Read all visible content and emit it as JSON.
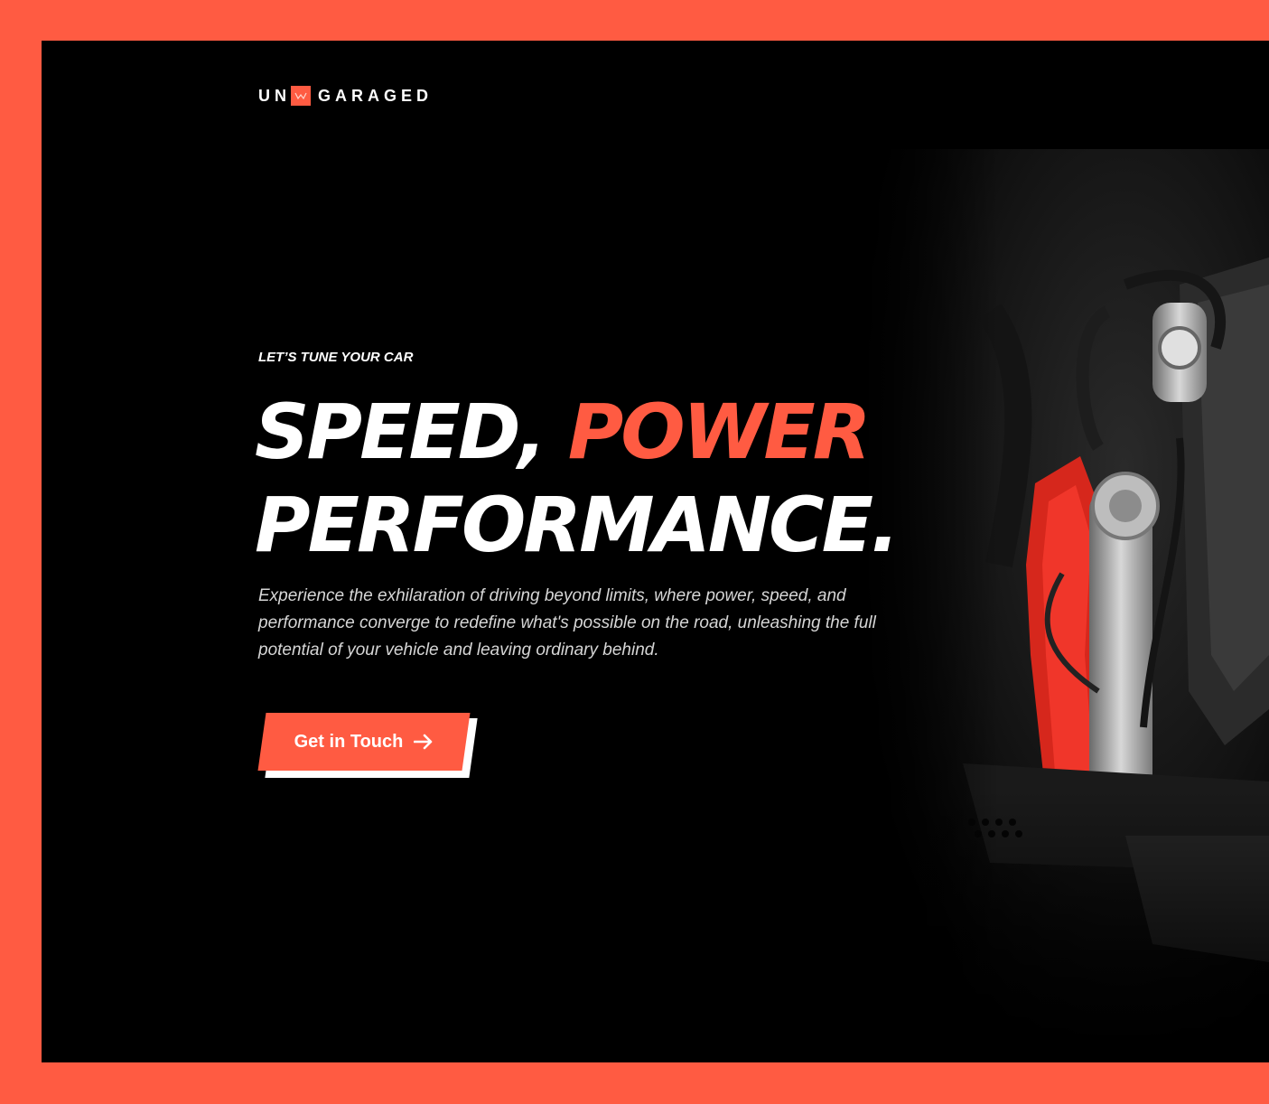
{
  "brand": {
    "left": "UN",
    "right": "GARAGED",
    "icon": "logo-mark-icon",
    "accent_color": "#ff5b42"
  },
  "hero": {
    "eyebrow": "LET’S TUNE YOUR CAR",
    "headline_white_1": "SPEED, ",
    "headline_accent": "POWER",
    "headline_white_2": "PERFORMANCE.",
    "description": "Experience the exhilaration of driving beyond limits, where power, speed, and performance converge to redefine what's possible on the road, unleashing the full potential of your vehicle and leaving ordinary behind."
  },
  "cta": {
    "label": "Get in Touch",
    "icon": "arrow-right-icon"
  },
  "colors": {
    "border": "#ff5b42",
    "background": "#000000",
    "text": "#ffffff"
  }
}
